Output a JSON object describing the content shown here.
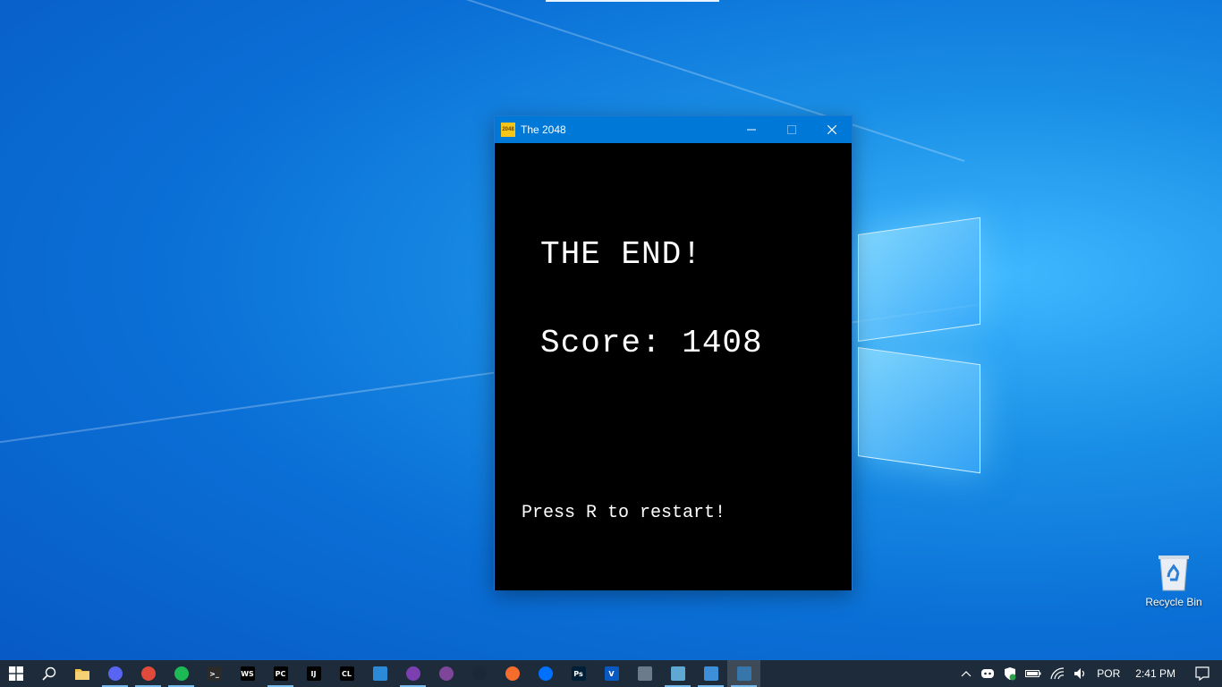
{
  "window": {
    "title": "The 2048",
    "icon_label": "2048",
    "minimize": "minimize",
    "maximize": "maximize",
    "close": "close"
  },
  "game": {
    "end_text": "THE END!",
    "score_text": "Score: 1408",
    "score_value": 1408,
    "restart_text": "Press R to restart!"
  },
  "desktop": {
    "recycle_bin_label": "Recycle Bin"
  },
  "taskbar": {
    "apps": [
      {
        "name": "discord",
        "label": "",
        "color": "#5865f2",
        "running": true
      },
      {
        "name": "chrome",
        "label": "",
        "color": "#e04a3a",
        "running": true
      },
      {
        "name": "spotify",
        "label": "",
        "color": "#1db954",
        "running": true
      },
      {
        "name": "terminal",
        "label": ">_",
        "color": "#2b2b2b",
        "running": false
      },
      {
        "name": "webstorm",
        "label": "WS",
        "color": "#000000",
        "running": false
      },
      {
        "name": "pycharm",
        "label": "PC",
        "color": "#000000",
        "running": true
      },
      {
        "name": "intellij",
        "label": "IJ",
        "color": "#000000",
        "running": false
      },
      {
        "name": "clion",
        "label": "CL",
        "color": "#000000",
        "running": false
      },
      {
        "name": "vscode",
        "label": "",
        "color": "#2a8ad8",
        "running": false
      },
      {
        "name": "github-desktop",
        "label": "",
        "color": "#7b3fb0",
        "running": true
      },
      {
        "name": "tor-browser",
        "label": "",
        "color": "#7d4698",
        "running": false
      },
      {
        "name": "steam",
        "label": "",
        "color": "#1b2838",
        "running": false
      },
      {
        "name": "origin",
        "label": "",
        "color": "#f56c2d",
        "running": false
      },
      {
        "name": "ubisoft",
        "label": "",
        "color": "#0070ff",
        "running": false
      },
      {
        "name": "photoshop",
        "label": "Ps",
        "color": "#001e36",
        "running": false
      },
      {
        "name": "vegas",
        "label": "V",
        "color": "#0a58c2",
        "running": false
      },
      {
        "name": "calculator",
        "label": "",
        "color": "#6b7b8c",
        "running": false
      },
      {
        "name": "notepad",
        "label": "",
        "color": "#5fa8d3",
        "running": true
      },
      {
        "name": "settings",
        "label": "",
        "color": "#3c8fd8",
        "running": true
      },
      {
        "name": "python-game",
        "label": "",
        "color": "#3776ab",
        "running": true,
        "active": true
      }
    ],
    "language": "POR",
    "time": "2:41 PM"
  }
}
